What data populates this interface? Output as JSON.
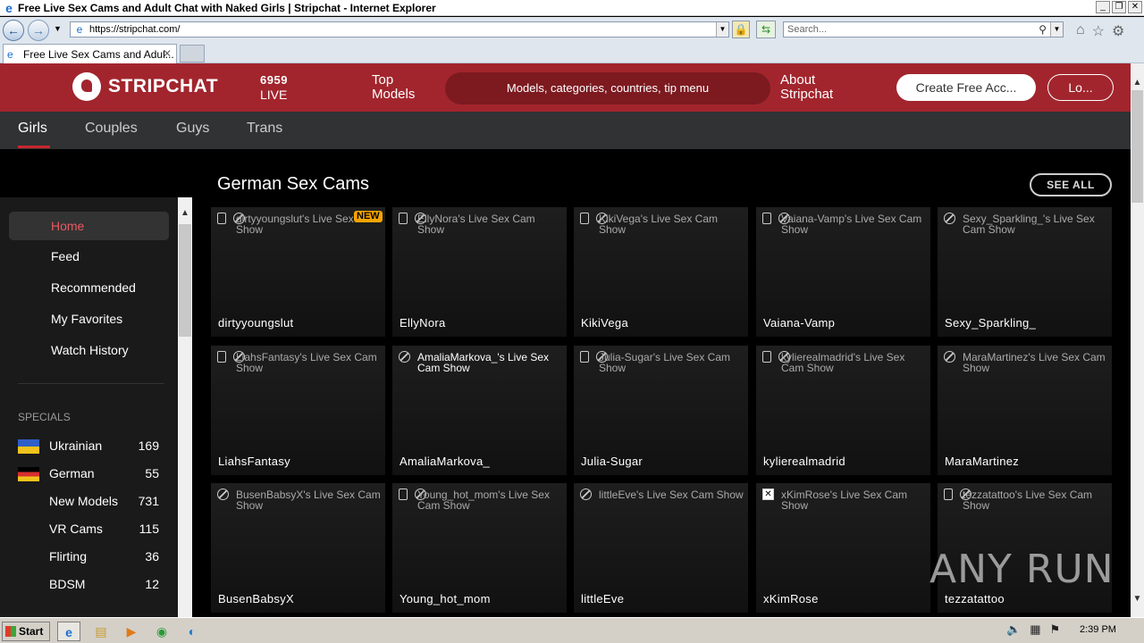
{
  "browser": {
    "window_title": "Free Live Sex Cams and Adult Chat with Naked Girls | Stripchat - Internet Explorer",
    "url": "https://stripchat.com/",
    "search_placeholder": "Search...",
    "tab_title": "Free Live Sex Cams and Adul...",
    "tab_close": "✕"
  },
  "header": {
    "logo_text": "STRIPCHAT",
    "live_count": "6959",
    "live_label": "LIVE",
    "top_models_line1": "Top",
    "top_models_line2": "Models",
    "search_placeholder": "Models, categories, countries, tip menu",
    "about_line1": "About",
    "about_line2": "Stripchat",
    "create_account": "Create Free Acc...",
    "login": "Lo..."
  },
  "categories": [
    "Girls",
    "Couples",
    "Guys",
    "Trans"
  ],
  "sidebar": {
    "home": "Home",
    "items": [
      "Feed",
      "Recommended",
      "My Favorites",
      "Watch History"
    ],
    "specials_label": "SPECIALS",
    "specials": [
      {
        "label": "Ukrainian",
        "count": "169",
        "flag": "ukraine-flag"
      },
      {
        "label": "German",
        "count": "55",
        "flag": "germany-flag"
      },
      {
        "label": "New Models",
        "count": "731",
        "flag": ""
      },
      {
        "label": "VR Cams",
        "count": "115",
        "flag": ""
      },
      {
        "label": "Flirting",
        "count": "36",
        "flag": ""
      },
      {
        "label": "BDSM",
        "count": "12",
        "flag": ""
      }
    ]
  },
  "main": {
    "section_title": "German Sex Cams",
    "see_all": "SEE ALL",
    "new_badge": "NEW",
    "cards": [
      {
        "name": "dirtyyoungslut",
        "alt": "dirtyyoungslut's Live Sex Cam Show",
        "icons": "mobile-vr"
      },
      {
        "name": "EllyNora",
        "alt": "EllyNora's Live Sex Cam Show",
        "icons": "mobile-vr"
      },
      {
        "name": "KikiVega",
        "alt": "KikiVega's Live Sex Cam Show",
        "icons": "mobile-vr"
      },
      {
        "name": "Vaiana-Vamp",
        "alt": "Vaiana-Vamp's Live Sex Cam Show",
        "icons": "mobile-vr"
      },
      {
        "name": "Sexy_Sparkling_",
        "alt": "Sexy_Sparkling_'s Live Sex Cam Show",
        "icons": "vr"
      },
      {
        "name": "LiahsFantasy",
        "alt": "LiahsFantasy's Live Sex Cam Show",
        "icons": "mobile-vr"
      },
      {
        "name": "AmaliaMarkova_",
        "alt": "AmaliaMarkova_'s Live Sex Cam Show",
        "icons": "vr"
      },
      {
        "name": "Julia-Sugar",
        "alt": "Julia-Sugar's Live Sex Cam Show",
        "icons": "mobile-vr"
      },
      {
        "name": "kylierealmadrid",
        "alt": "kylierealmadrid's Live Sex Cam Show",
        "icons": "mobile-vr"
      },
      {
        "name": "MaraMartinez",
        "alt": "MaraMartinez's Live Sex Cam Show",
        "icons": "vr"
      },
      {
        "name": "BusenBabsyX",
        "alt": "BusenBabsyX's Live Sex Cam Show",
        "icons": "vr"
      },
      {
        "name": "Young_hot_mom",
        "alt": "Young_hot_mom's Live Sex Cam Show",
        "icons": "mobile-vr"
      },
      {
        "name": "littleEve",
        "alt": "littleEve's Live Sex Cam Show",
        "icons": "vr"
      },
      {
        "name": "xKimRose",
        "alt": "xKimRose's Live Sex Cam Show",
        "icons": "broken"
      },
      {
        "name": "tezzatattoo",
        "alt": "tezzatattoo's Live Sex Cam Show",
        "icons": "mobile-vr"
      }
    ]
  },
  "watermark": "ANY RUN",
  "taskbar": {
    "start": "Start",
    "clock": "2:39 PM"
  },
  "colors": {
    "brand_red": "#a2252d",
    "nav_bg": "#303234",
    "active_accent": "#e85a62",
    "new_badge": "#f6a500"
  }
}
